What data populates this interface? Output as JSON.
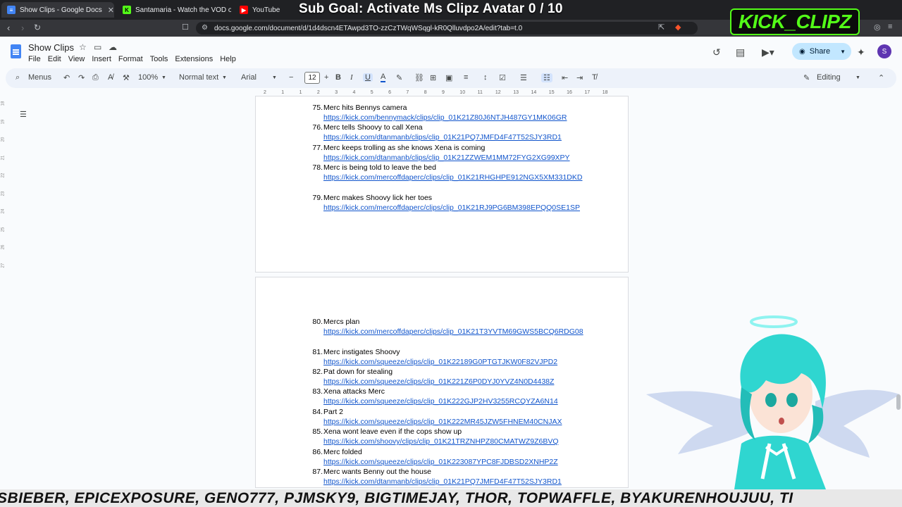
{
  "tabs": [
    {
      "label": "Show Clips - Google Docs",
      "icon": "google-docs-icon",
      "active": true
    },
    {
      "label": "Santamaria - Watch the VOD on Kick",
      "icon": "kick-icon"
    },
    {
      "label": "YouTube",
      "icon": "youtube-icon"
    }
  ],
  "overlay": {
    "goal": "Sub Goal: Activate Ms Clipz Avatar  0 / 10",
    "logo": "KICK_CLIPZ"
  },
  "address": {
    "url": "docs.google.com/document/d/1d4dscn4ETAwpd3TO-zzCzTWqWSqgl-kR0Qlluvdpo2A/edit?tab=t.0"
  },
  "doc": {
    "title": "Show Clips",
    "menus": [
      "File",
      "Edit",
      "View",
      "Insert",
      "Format",
      "Tools",
      "Extensions",
      "Help"
    ],
    "share": "Share",
    "avatar_letter": "S"
  },
  "toolbar": {
    "search": "Menus",
    "zoom": "100%",
    "style": "Normal text",
    "font": "Arial",
    "font_size": "12",
    "mode": "Editing"
  },
  "ruler": [
    "2",
    "1",
    "1",
    "2",
    "3",
    "4",
    "5",
    "6",
    "7",
    "8",
    "9",
    "10",
    "11",
    "12",
    "13",
    "14",
    "15",
    "16",
    "17",
    "18"
  ],
  "vruler": [
    "18",
    "19",
    "20",
    "21",
    "22",
    "23",
    "24",
    "25",
    "26",
    "27"
  ],
  "page1_entries": [
    {
      "num": "75.",
      "title": "Merc hits Bennys camera",
      "link": "https://kick.com/bennymack/clips/clip_01K21Z80J6NTJH487GY1MK06GR"
    },
    {
      "num": "76.",
      "title": "Merc tells Shoovy to call Xena",
      "link": "https://kick.com/dtanmanb/clips/clip_01K21PQ7JMFD4F47T52SJY3RD1"
    },
    {
      "num": "77.",
      "title": "Merc keeps trolling as she knows Xena is coming",
      "link": "https://kick.com/dtanmanb/clips/clip_01K21ZZWEM1MM72FYG2XG99XPY"
    },
    {
      "num": "78.",
      "title": "Merc is being told to leave the bed",
      "link": "https://kick.com/mercoffdaperc/clips/clip_01K21RHGHPE912NGX5XM331DKD"
    },
    {
      "num": "79.",
      "title": "Merc makes Shoovy lick her toes",
      "link": "https://kick.com/mercoffdaperc/clips/clip_01K21RJ9PG6BM398EPQQ0SE1SP"
    }
  ],
  "page2_entries": [
    {
      "num": "80.",
      "title": "Mercs plan",
      "link": "https://kick.com/mercoffdaperc/clips/clip_01K21T3YVTM69GWS5BCQ6RDG08"
    },
    {
      "num": "81.",
      "title": "Merc instigates Shoovy",
      "link": "https://kick.com/squeeze/clips/clip_01K22189G0PTGTJKW0F82VJPD2"
    },
    {
      "num": "82.",
      "title": "Pat down for stealing",
      "link": "https://kick.com/squeeze/clips/clip_01K221Z6P0DYJ0YVZ4N0D4438Z"
    },
    {
      "num": "83.",
      "title": "Xena attacks Merc",
      "link": "https://kick.com/squeeze/clips/clip_01K222GJP2HV3255RCQYZA6N14"
    },
    {
      "num": "84.",
      "title": "Part 2",
      "link": "https://kick.com/squeeze/clips/clip_01K222MR45JZW5FHNEM40CNJAX"
    },
    {
      "num": "85.",
      "title": "Xena wont leave even if the cops show up",
      "link": "https://kick.com/shoovy/clips/clip_01K21TRZNHPZ80CMATWZ9Z6BVQ"
    },
    {
      "num": "86.",
      "title": "Merc folded",
      "link": "https://kick.com/squeeze/clips/clip_01K223087YPC8FJDBSD2XNHP2Z"
    },
    {
      "num": "87.",
      "title": "Merc wants Benny out the house",
      "link": "https://kick.com/dtanmanb/clips/clip_01K21PQ7JMFD4F47T52SJY3RD1"
    }
  ],
  "ticker": "SBIEBER, EPICEXPOSURE, GENO777, PJMSKY9, BIGTIMEJAY, THOR, TOPWAFFLE, BYAKURENHOUJUU, TI",
  "colors": {
    "accent": "#53fc18",
    "link": "#1155cc",
    "share_bg": "#c2e7ff"
  }
}
